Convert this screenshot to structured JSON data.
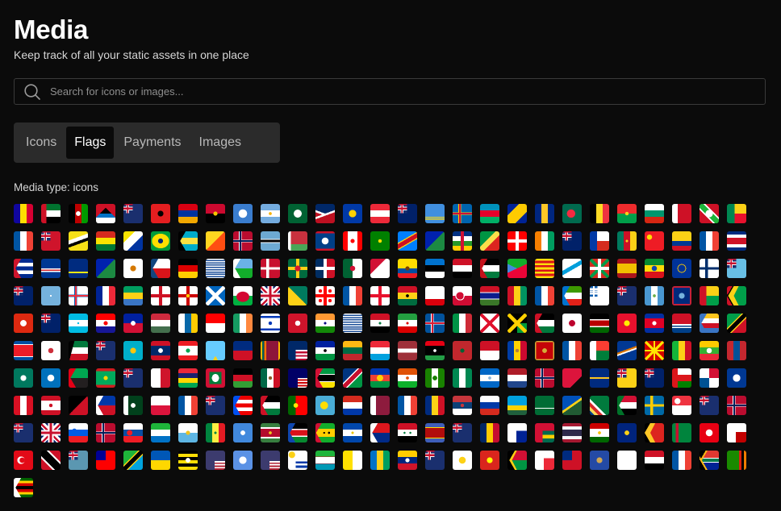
{
  "header": {
    "title": "Media",
    "subtitle": "Keep track of all your static assets in one place"
  },
  "search": {
    "placeholder": "Search for icons or images...",
    "value": "",
    "icon": "search-icon"
  },
  "tabs": [
    {
      "label": "Icons",
      "active": false
    },
    {
      "label": "Flags",
      "active": true
    },
    {
      "label": "Payments",
      "active": false
    },
    {
      "label": "Images",
      "active": false
    }
  ],
  "media_type_label": "Media type: icons",
  "colors": {
    "background": "#0b0b0b",
    "tab_bar": "#2b2b2b",
    "active_tab": "#0a0a0a",
    "border": "#3a3a3a"
  },
  "flags": {
    "per_row": 27,
    "items": [
      "andorra",
      "united-arab-emirates",
      "afghanistan",
      "antigua-and-barbuda",
      "anguilla",
      "albania",
      "armenia",
      "angola",
      "antarctica",
      "argentina",
      "arab-league",
      "american-samoa",
      "asean",
      "austria",
      "australia",
      "aruba",
      "aland-islands",
      "azerbaijan",
      "bosnia-and-herzegovina",
      "barbados",
      "bangladesh",
      "belgium",
      "burkina-faso",
      "bulgaria",
      "bahrain",
      "burundi",
      "benin",
      "saint-barthelemy",
      "bermuda",
      "brunei",
      "bolivia",
      "bonaire",
      "brazil",
      "bahamas",
      "bhutan",
      "bouvet-island",
      "botswana",
      "belarus",
      "belize",
      "canada",
      "cocos-islands",
      "congo-kinshasa",
      "christmas-island",
      "central-african-republic",
      "congo-brazzaville",
      "switzerland",
      "cote-divoire",
      "cook-islands",
      "chile",
      "cameroon",
      "china",
      "colombia",
      "clipperton-island",
      "costa-rica",
      "cuba",
      "cape-verde",
      "curacao",
      "christmas-island",
      "cyprus",
      "czechia",
      "germany",
      "diego-garcia",
      "djibouti",
      "denmark",
      "dominica",
      "dominican-republic",
      "algeria",
      "ceuta-melilla",
      "ecuador",
      "estonia",
      "egypt",
      "western-sahara",
      "eritrea",
      "catalonia",
      "galicia",
      "basque-country",
      "spain",
      "ethiopia",
      "european-union",
      "finland",
      "fiji",
      "falkland-islands",
      "micronesia",
      "faroe-islands",
      "france",
      "gabon",
      "england",
      "northern-ireland",
      "scotland",
      "wales",
      "united-kingdom",
      "grenada",
      "georgia",
      "french-guiana",
      "guernsey",
      "ghana",
      "gibraltar",
      "greenland",
      "gambia",
      "guinea",
      "guadeloupe",
      "equatorial-guinea",
      "greece",
      "south-georgia",
      "guatemala",
      "guam",
      "guinea-bissau",
      "guyana",
      "hong-kong",
      "heard-island",
      "honduras",
      "croatia",
      "haiti",
      "hungary",
      "canary-islands",
      "indonesia",
      "ireland",
      "israel",
      "isle-of-man",
      "india",
      "british-indian-ocean-territory",
      "iraq",
      "iran",
      "iceland",
      "italy",
      "jersey",
      "jamaica",
      "jordan",
      "japan",
      "kenya",
      "kyrgyzstan",
      "cambodia",
      "kiribati",
      "comoros",
      "saint-kitts-and-nevis",
      "north-korea",
      "south-korea",
      "kuwait",
      "cayman-islands",
      "kazakhstan",
      "laos",
      "lebanon",
      "saint-lucia",
      "liechtenstein",
      "sri-lanka",
      "liberia",
      "lesotho",
      "lithuania",
      "luxembourg",
      "latvia",
      "libya",
      "morocco",
      "monaco",
      "moldova",
      "montenegro",
      "saint-martin",
      "madagascar",
      "marshall-islands",
      "north-macedonia",
      "mali",
      "myanmar",
      "mongolia",
      "macau",
      "northern-mariana-islands",
      "martinique",
      "mauritania",
      "montserrat",
      "malta",
      "mauritius",
      "maldives",
      "malawi",
      "mexico",
      "malaysia",
      "mozambique",
      "namibia",
      "new-caledonia",
      "niger",
      "norfolk-island",
      "nigeria",
      "nicaragua",
      "netherlands",
      "norway",
      "nepal",
      "nauru",
      "niue",
      "new-zealand",
      "oman",
      "panama",
      "peru-emblem",
      "peru",
      "french-polynesia",
      "papua-new-guinea",
      "philippines",
      "pakistan",
      "poland",
      "saint-pierre",
      "pitcairn",
      "puerto-rico",
      "palestine",
      "portugal",
      "palau",
      "paraguay",
      "qatar",
      "reunion",
      "romania",
      "serbia",
      "russia",
      "rwanda",
      "saudi-arabia",
      "solomon-islands",
      "seychelles",
      "sudan",
      "sweden",
      "singapore",
      "saint-helena",
      "svalbard",
      "tristan-da-cunha",
      "united-kingdom-2",
      "slovenia",
      "svalbard-2",
      "slovakia",
      "sierra-leone",
      "san-marino",
      "senegal",
      "somalia",
      "suriname",
      "south-sudan",
      "sao-tome",
      "el-salvador",
      "sint-maarten",
      "syria",
      "eswatini",
      "turks-and-caicos",
      "chad",
      "french-southern-territories",
      "togo",
      "thailand",
      "tajikistan",
      "tokelau",
      "timor-leste",
      "turkmenistan",
      "tunisia",
      "tonga",
      "turkey",
      "trinidad-and-tobago",
      "tuvalu",
      "taiwan",
      "tanzania",
      "ukraine",
      "uganda",
      "us-outlying-islands",
      "united-nations",
      "united-states",
      "uruguay",
      "uzbekistan",
      "vatican-city",
      "saint-vincent",
      "venezuela",
      "british-virgin-islands",
      "us-virgin-islands",
      "vietnam",
      "vanuatu",
      "wallis-and-futuna",
      "samoa",
      "kosovo",
      "blank",
      "yemen",
      "mayotte",
      "south-africa",
      "zambia",
      "zimbabwe"
    ]
  }
}
